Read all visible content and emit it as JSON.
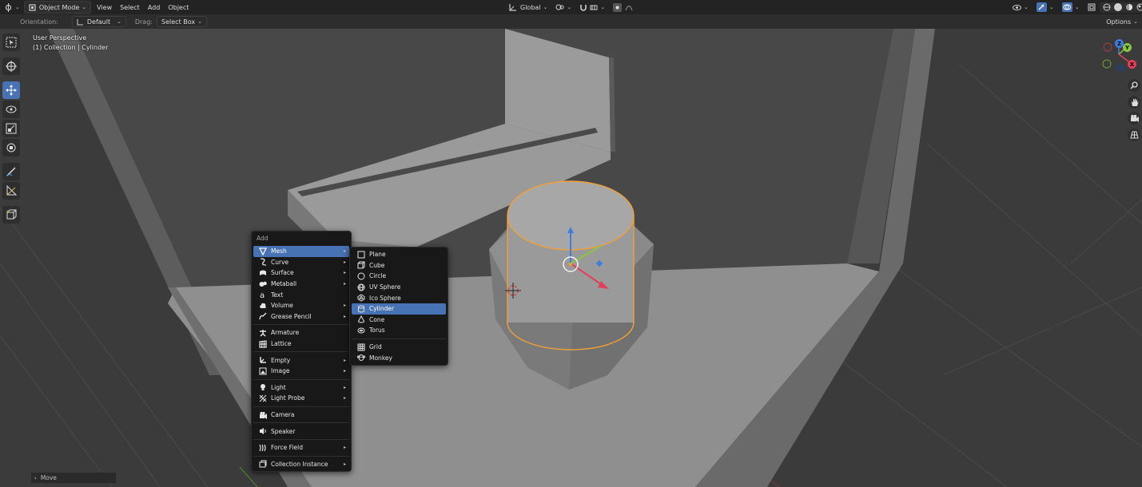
{
  "header": {
    "mode": "Object Mode",
    "menus": [
      "View",
      "Select",
      "Add",
      "Object"
    ],
    "transform_space": "Global",
    "options": "Options"
  },
  "tool_settings": {
    "orientation_label": "Orientation:",
    "orientation_value": "Default",
    "drag_label": "Drag:",
    "drag_value": "Select Box"
  },
  "overlay": {
    "view_name": "User Perspective",
    "collection_info": "(1) Collection | Cylinder"
  },
  "gizmo": {
    "z": "Z",
    "y": "Y",
    "x": "X"
  },
  "add_menu": {
    "title": "Add",
    "items": [
      {
        "label": "Mesh",
        "icon": "mesh-icon",
        "submenu": true
      },
      {
        "label": "Curve",
        "icon": "curve-icon",
        "submenu": true
      },
      {
        "label": "Surface",
        "icon": "surface-icon",
        "submenu": true
      },
      {
        "label": "Metaball",
        "icon": "metaball-icon",
        "submenu": true
      },
      {
        "label": "Text",
        "icon": "text-icon",
        "submenu": false
      },
      {
        "label": "Volume",
        "icon": "volume-icon",
        "submenu": true
      },
      {
        "label": "Grease Pencil",
        "icon": "grease-pencil-icon",
        "submenu": true
      },
      {
        "label": "Armature",
        "icon": "armature-icon",
        "submenu": false
      },
      {
        "label": "Lattice",
        "icon": "lattice-icon",
        "submenu": false
      },
      {
        "label": "Empty",
        "icon": "empty-icon",
        "submenu": true
      },
      {
        "label": "Image",
        "icon": "image-icon",
        "submenu": true
      },
      {
        "label": "Light",
        "icon": "light-icon",
        "submenu": true
      },
      {
        "label": "Light Probe",
        "icon": "light-probe-icon",
        "submenu": true
      },
      {
        "label": "Camera",
        "icon": "camera-icon",
        "submenu": false
      },
      {
        "label": "Speaker",
        "icon": "speaker-icon",
        "submenu": false
      },
      {
        "label": "Force Field",
        "icon": "force-field-icon",
        "submenu": true
      },
      {
        "label": "Collection Instance",
        "icon": "collection-instance-icon",
        "submenu": true
      }
    ]
  },
  "mesh_menu": {
    "items": [
      {
        "label": "Plane",
        "icon": "plane-icon"
      },
      {
        "label": "Cube",
        "icon": "cube-icon"
      },
      {
        "label": "Circle",
        "icon": "circle-icon"
      },
      {
        "label": "UV Sphere",
        "icon": "uv-sphere-icon"
      },
      {
        "label": "Ico Sphere",
        "icon": "ico-sphere-icon"
      },
      {
        "label": "Cylinder",
        "icon": "cylinder-icon"
      },
      {
        "label": "Cone",
        "icon": "cone-icon"
      },
      {
        "label": "Torus",
        "icon": "torus-icon"
      },
      {
        "label": "Grid",
        "icon": "grid-icon"
      },
      {
        "label": "Monkey",
        "icon": "monkey-icon"
      }
    ],
    "highlighted": "Cylinder"
  },
  "status": {
    "last_operation": "Move"
  },
  "colors": {
    "accent": "#4772b3",
    "selection_outline": "#f29f38",
    "axis_x": "#e2405a",
    "axis_y": "#8bc73e",
    "axis_z": "#3d7fe0"
  }
}
